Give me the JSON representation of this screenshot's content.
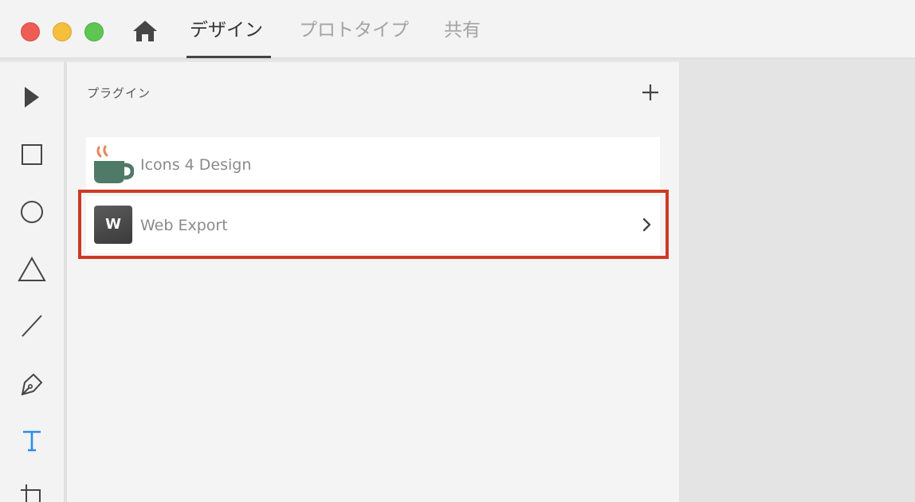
{
  "window": {
    "controls": [
      "close",
      "minimize",
      "zoom"
    ]
  },
  "tabs": [
    {
      "label": "デザイン",
      "active": true
    },
    {
      "label": "プロトタイプ",
      "active": false
    },
    {
      "label": "共有",
      "active": false
    }
  ],
  "tools": [
    "select-arrow-icon",
    "rectangle-icon",
    "ellipse-icon",
    "triangle-icon",
    "line-icon",
    "pen-icon",
    "text-icon",
    "artboard-icon"
  ],
  "panel": {
    "title": "プラグイン",
    "plugins": [
      {
        "name": "Icons 4 Design",
        "icon": "coffee-cup-icon"
      },
      {
        "name": "Web Export",
        "icon": "web-export-icon",
        "icon_letter": "W",
        "selected": true
      }
    ]
  },
  "colors": {
    "highlight": "#cc3b25",
    "text_tool_active": "#2d8ceb",
    "cup": "#4f7a68",
    "steam": "#e8875e"
  }
}
